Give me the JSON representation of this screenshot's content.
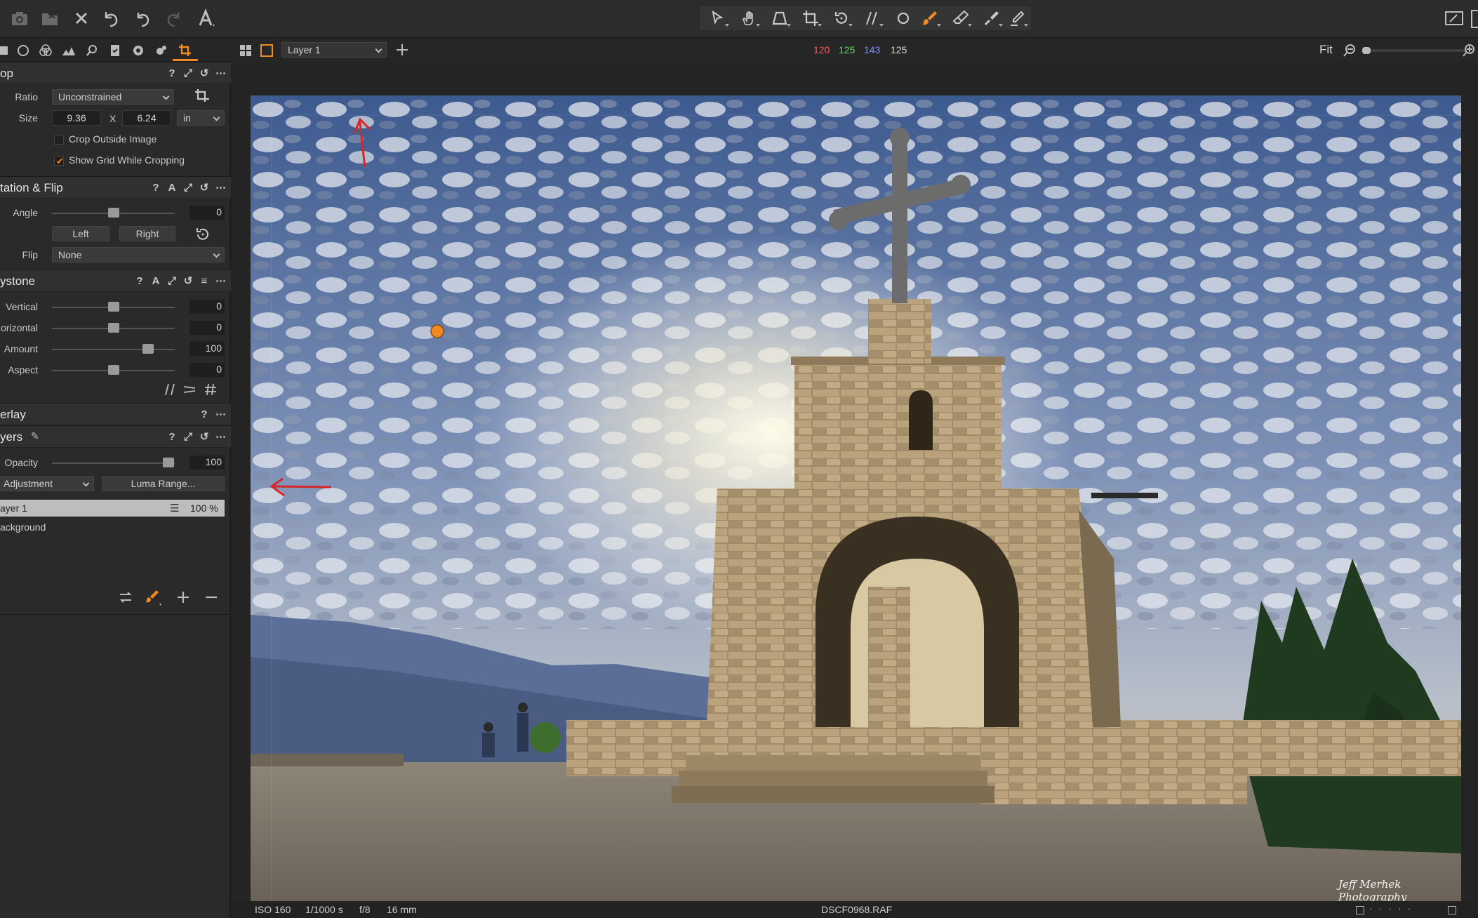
{
  "toolbar": {
    "left_icons": [
      "camera-icon",
      "open-folder-icon",
      "close-x-icon",
      "undo-all-icon",
      "undo-icon",
      "redo-icon",
      "text-icon"
    ],
    "center_tools": [
      "select-cursor-icon",
      "pan-hand-icon",
      "keystone-icon",
      "crop-icon",
      "rotate-icon",
      "straighten-icon",
      "circle-icon",
      "brush-icon",
      "eraser-icon",
      "gradient-icon",
      "pen-icon"
    ],
    "active_tool": "brush-icon",
    "accent_color": "#f08a24"
  },
  "panel_tabs": [
    "library-icon",
    "capture-icon",
    "color-icon",
    "exposure-icon",
    "lens-icon",
    "details-icon",
    "adjustments-icon",
    "metadata-icon",
    "crop-tab-icon"
  ],
  "crop": {
    "title": "op",
    "ratio_label": "Ratio",
    "ratio_value": "Unconstrained",
    "size_label": "Size",
    "width": "9.36",
    "x_label": "X",
    "height": "6.24",
    "unit": "in",
    "crop_outside_label": "Crop Outside Image",
    "crop_outside_checked": false,
    "show_grid_label": "Show Grid While Cropping",
    "show_grid_checked": true
  },
  "rotation": {
    "title": "tation & Flip",
    "angle_label": "Angle",
    "angle_value": "0",
    "left_label": "Left",
    "right_label": "Right",
    "flip_label": "Flip",
    "flip_value": "None"
  },
  "keystone": {
    "title": "ystone",
    "rows": [
      {
        "label": "Vertical",
        "value": "0",
        "level": 0.5
      },
      {
        "label": "orizontal",
        "value": "0",
        "level": 0.5
      },
      {
        "label": "Amount",
        "value": "100",
        "level": 0.78
      },
      {
        "label": "Aspect",
        "value": "0",
        "level": 0.5
      }
    ]
  },
  "overlay": {
    "title": "erlay"
  },
  "layers": {
    "title": "yers",
    "opacity_label": "Opacity",
    "opacity_value": "100",
    "adjustment_value": "Adjustment",
    "luma_label": "Luma Range...",
    "layer1_name": "ayer 1",
    "layer1_percent": "100 %",
    "background_name": "ackground"
  },
  "viewbar": {
    "layer_select": "Layer 1",
    "rgb_r": "120",
    "rgb_g": "125",
    "rgb_b": "143",
    "lum": "125",
    "fit_label": "Fit",
    "zoom_level": 0.08
  },
  "status": {
    "iso": "ISO 160",
    "shutter": "1/1000 s",
    "aperture": "f/8",
    "focal": "16 mm",
    "filename": "DSCF0968.RAF"
  },
  "watermark": "Jeff Merhek Photography"
}
